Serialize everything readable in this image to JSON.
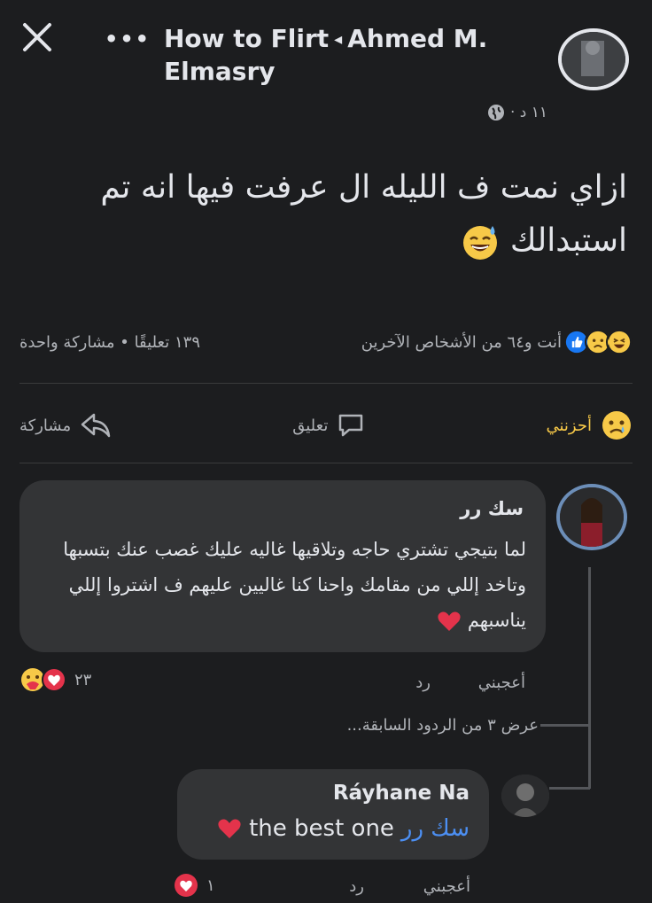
{
  "header": {
    "close_label": "×",
    "more_label": "•••",
    "group_name": "How to Flirt",
    "arrow": "◂",
    "author": "Ahmed M. Elmasry"
  },
  "post": {
    "time": "١١ د ·",
    "text": "ازاي نمت ف الليله ال عرفت فيها انه تم استبدالك",
    "emoji_name": "sweat-smile-emoji"
  },
  "stats": {
    "reactors": "أنت و٦٤ من الأشخاص الآخرين",
    "comments_shares": "١٣٩ تعليقًا • مشاركة واحدة"
  },
  "actions": {
    "react_label": "أحزنني",
    "comment_label": "تعليق",
    "share_label": "مشاركة"
  },
  "comment1": {
    "author": "سك رر",
    "text": "لما بتيجي تشتري حاجه وتلاقيها غاليه عليك غصب عنك بتسبها وتاخد إللي من مقامك واحنا كنا غاليين عليهم ف اشتروا إللي يناسبهم",
    "like_label": "أعجبني",
    "reply_label": "رد",
    "reaction_count": "٢٣"
  },
  "view_previous": "عرض ٣ من الردود السابقة...",
  "reply1": {
    "author": "Ráyhane Na",
    "mention": "سك رر",
    "text": "the best one",
    "like_label": "أعجبني",
    "reply_label": "رد",
    "reaction_count": "١"
  },
  "colors": {
    "background": "#1c1d1f",
    "bubble": "#333436",
    "mention": "#4c8ff3",
    "heart": "#e4334b"
  }
}
